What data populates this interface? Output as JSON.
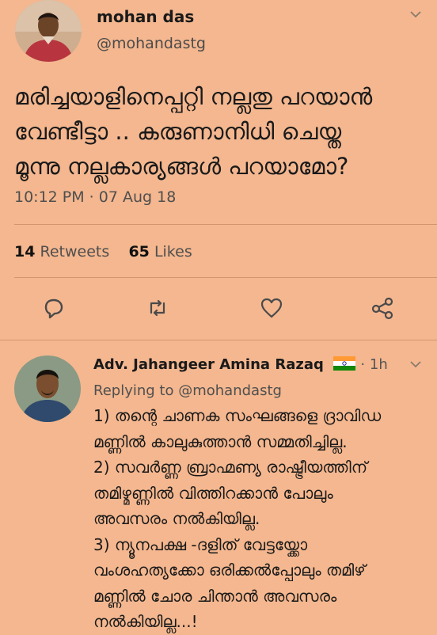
{
  "tweet": {
    "display_name": "mohan das",
    "handle": "@mohandastg",
    "text_lines": [
      "മരിച്ചയാളിനെപ്പറ്റി നല്ലതു പറയാൻ",
      "വേണ്ടീട്ടാ .. കരുണാനിധി ചെയ്ത",
      "മൂന്നു നല്ലകാര്യങ്ങൾ പറയാമോ?"
    ],
    "time": "10:12 PM · 07 Aug 18",
    "stats": {
      "retweets_count": "14",
      "retweets_label": "Retweets",
      "likes_count": "65",
      "likes_label": "Likes"
    },
    "actions": [
      "reply-icon",
      "retweet-icon",
      "like-icon",
      "share-icon"
    ]
  },
  "reply": {
    "display_name": "Adv. Jahangeer Amina Razaq",
    "meta": "· 1h",
    "replying_prefix": "Replying to",
    "replying_to": "@mohandastg",
    "text_lines": [
      "1) തന്റെ ചാണക സംഘങ്ങളെ ദ്രാവിഡ",
      "മണ്ണിൽ കാലുകുത്താൻ സമ്മതിച്ചില്ല.",
      "2) സവർണ്ണ ബ്രാഹ്മണ്യ രാഷ്ട്രീയത്തിന്",
      "തമിഴ്മണ്ണിൽ വിത്തിറക്കാൻ പോലും",
      "അവസരം നൽകിയില്ല.",
      "3) ന്യൂനപക്ഷ -ദളിത് വേട്ടയ്ക്കോ",
      "വംശഹത്യക്കോ ഒരിക്കൽപ്പോലും തമിഴ്",
      "മണ്ണിൽ ചോര ചിന്താൻ അവസരം",
      "നൽകിയില്ല...!"
    ]
  },
  "colors": {
    "background": "#f4b78f",
    "divider": "#d2956e",
    "icon": "#4a4a4a"
  }
}
